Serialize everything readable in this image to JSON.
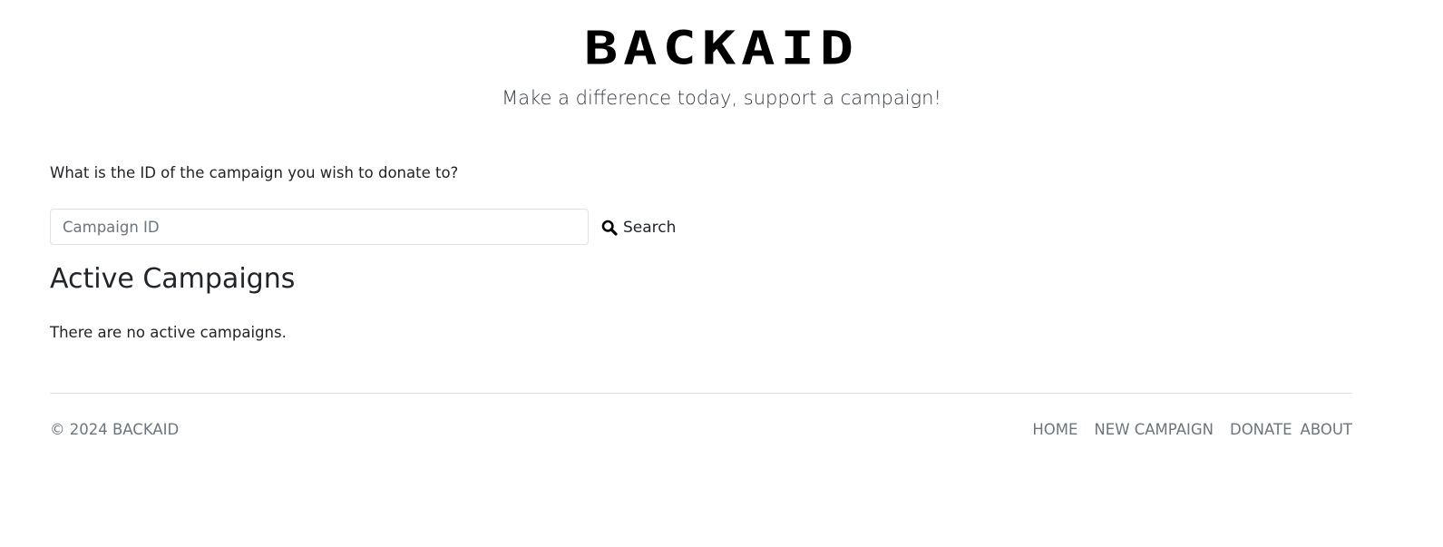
{
  "header": {
    "brand": "BACKAID",
    "tagline": "Make a difference today, support a campaign!"
  },
  "search": {
    "question": "What is the ID of the campaign you wish to donate to?",
    "placeholder": "Campaign ID",
    "value": "",
    "button_label": "Search",
    "button_icon": "search-icon"
  },
  "campaigns": {
    "title": "Active Campaigns",
    "empty_message": "There are no active campaigns."
  },
  "footer": {
    "copyright": "© 2024 BACKAID",
    "nav": {
      "home": "HOME",
      "new_campaign": "NEW CAMPAIGN",
      "donate": "DONATE",
      "about": "ABOUT"
    }
  },
  "colors": {
    "text": "#212529",
    "muted": "#6c757d",
    "border": "#dee2e6",
    "brand": "#000000"
  }
}
